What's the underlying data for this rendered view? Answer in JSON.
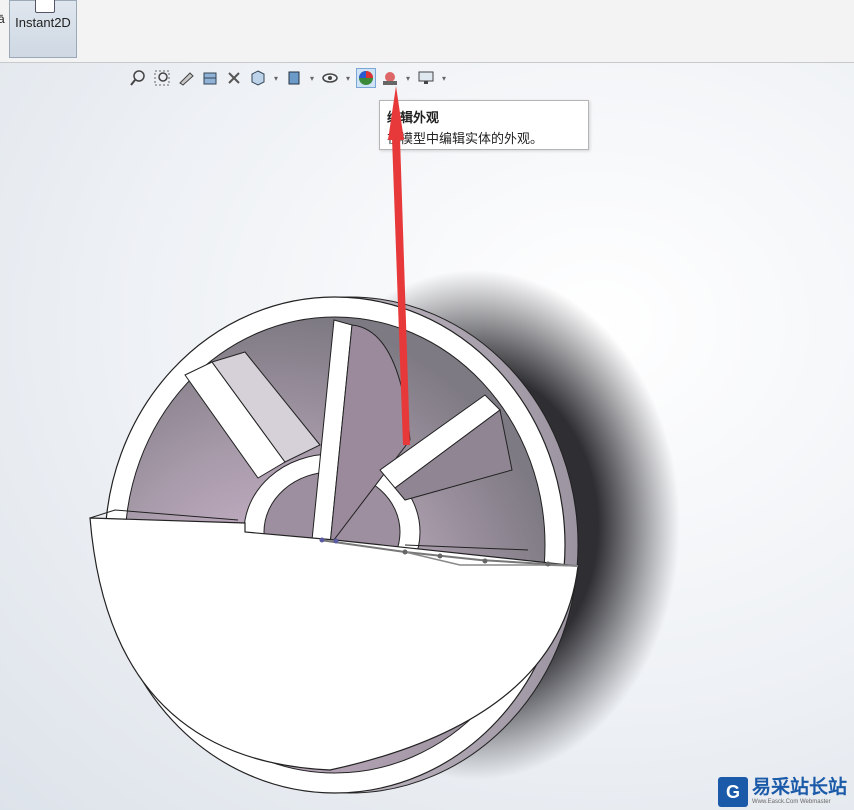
{
  "ribbon": {
    "edge_label": "ā",
    "instant2d_label": "Instant2D"
  },
  "heads_up_toolbar": {
    "icons": [
      "zoom-to-fit-icon",
      "zoom-to-area-icon",
      "previous-view-icon",
      "section-view-icon",
      "dynamic-annotation-icon",
      "view-orientation-icon",
      "display-style-icon",
      "hide-show-items-icon",
      "edit-appearance-icon",
      "apply-scene-icon",
      "view-settings-icon"
    ],
    "active": "edit-appearance-icon"
  },
  "tooltip": {
    "title": "编辑外观",
    "description": "在模型中编辑实体的外观。"
  },
  "watermark": {
    "logo_glyph": "G",
    "text_cn": "易采站长站",
    "text_en": "Www.Easck.Com Webmaster"
  },
  "colors": {
    "arrow": "#e8393a",
    "model_purple": "#a89aaa",
    "model_shadow": "#3a3a3e"
  }
}
